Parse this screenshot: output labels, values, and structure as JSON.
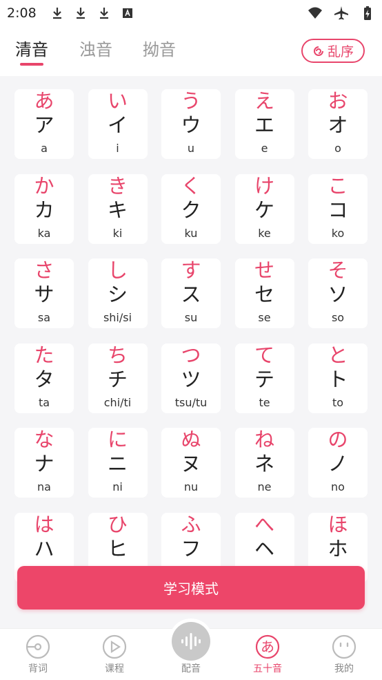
{
  "status": {
    "time": "2:08"
  },
  "tabs": [
    {
      "label": "清音",
      "active": true
    },
    {
      "label": "浊音",
      "active": false
    },
    {
      "label": "拗音",
      "active": false
    }
  ],
  "shuffle_label": "乱序",
  "kana": [
    {
      "h": "あ",
      "k": "ア",
      "r": "a"
    },
    {
      "h": "い",
      "k": "イ",
      "r": "i"
    },
    {
      "h": "う",
      "k": "ウ",
      "r": "u"
    },
    {
      "h": "え",
      "k": "エ",
      "r": "e"
    },
    {
      "h": "お",
      "k": "オ",
      "r": "o"
    },
    {
      "h": "か",
      "k": "カ",
      "r": "ka"
    },
    {
      "h": "き",
      "k": "キ",
      "r": "ki"
    },
    {
      "h": "く",
      "k": "ク",
      "r": "ku"
    },
    {
      "h": "け",
      "k": "ケ",
      "r": "ke"
    },
    {
      "h": "こ",
      "k": "コ",
      "r": "ko"
    },
    {
      "h": "さ",
      "k": "サ",
      "r": "sa"
    },
    {
      "h": "し",
      "k": "シ",
      "r": "shi/si"
    },
    {
      "h": "す",
      "k": "ス",
      "r": "su"
    },
    {
      "h": "せ",
      "k": "セ",
      "r": "se"
    },
    {
      "h": "そ",
      "k": "ソ",
      "r": "so"
    },
    {
      "h": "た",
      "k": "タ",
      "r": "ta"
    },
    {
      "h": "ち",
      "k": "チ",
      "r": "chi/ti"
    },
    {
      "h": "つ",
      "k": "ツ",
      "r": "tsu/tu"
    },
    {
      "h": "て",
      "k": "テ",
      "r": "te"
    },
    {
      "h": "と",
      "k": "ト",
      "r": "to"
    },
    {
      "h": "な",
      "k": "ナ",
      "r": "na"
    },
    {
      "h": "に",
      "k": "ニ",
      "r": "ni"
    },
    {
      "h": "ぬ",
      "k": "ヌ",
      "r": "nu"
    },
    {
      "h": "ね",
      "k": "ネ",
      "r": "ne"
    },
    {
      "h": "の",
      "k": "ノ",
      "r": "no"
    },
    {
      "h": "は",
      "k": "ハ",
      "r": ""
    },
    {
      "h": "ひ",
      "k": "ヒ",
      "r": ""
    },
    {
      "h": "ふ",
      "k": "フ",
      "r": ""
    },
    {
      "h": "へ",
      "k": "ヘ",
      "r": ""
    },
    {
      "h": "ほ",
      "k": "ホ",
      "r": ""
    }
  ],
  "study_button": "学习模式",
  "nav": [
    {
      "label": "背词",
      "icon": "recite-icon",
      "active": false
    },
    {
      "label": "课程",
      "icon": "play-icon",
      "active": false
    },
    {
      "label": "配音",
      "icon": "voice-wave-icon",
      "active": false
    },
    {
      "label": "五十音",
      "icon": "kana-a-icon",
      "active": true
    },
    {
      "label": "我的",
      "icon": "smiley-icon",
      "active": false
    }
  ],
  "colors": {
    "accent": "#e8456b",
    "button": "#ed4669",
    "background": "#f5f5f7"
  }
}
